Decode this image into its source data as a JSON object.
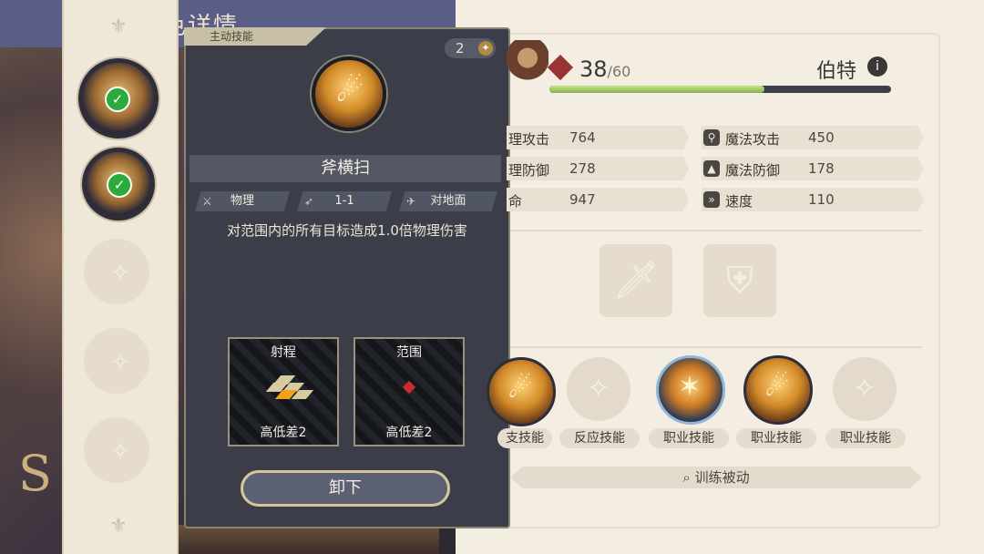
{
  "background_title": "角色详情",
  "left_slots": [
    {
      "state": "equipped",
      "check": "✓"
    },
    {
      "state": "equipped",
      "check": "✓"
    },
    {
      "state": "empty"
    },
    {
      "state": "empty"
    },
    {
      "state": "empty"
    }
  ],
  "skill_panel": {
    "tag": "主动技能",
    "level": "2",
    "name": "斧横扫",
    "attributes": {
      "damage_type": "物理",
      "range": "1-1",
      "target": "对地面"
    },
    "description": "对范围内的所有目标造成1.0倍物理伤害",
    "range_box": {
      "title": "射程",
      "footer": "高低差2"
    },
    "area_box": {
      "title": "范围",
      "footer": "高低差2"
    },
    "unequip_label": "卸下"
  },
  "hero": {
    "level": "38",
    "level_max": "/60",
    "name": "伯特",
    "xp_fraction": 0.63
  },
  "stats": [
    {
      "label": "理攻击",
      "value": "764"
    },
    {
      "label": "魔法攻击",
      "value": "450"
    },
    {
      "label": "理防御",
      "value": "278"
    },
    {
      "label": "魔法防御",
      "value": "178"
    },
    {
      "label": "命",
      "value": "947"
    },
    {
      "label": "速度",
      "value": "110"
    }
  ],
  "passive_labels": [
    "支技能",
    "反应技能",
    "职业技能",
    "职业技能",
    "职业技能"
  ],
  "train_label": "训练被动",
  "colors": {
    "panel": "#3b3e49",
    "accent_gold": "#d6c89a",
    "xp_green": "#86b34d",
    "check_green": "#2cab3a"
  }
}
